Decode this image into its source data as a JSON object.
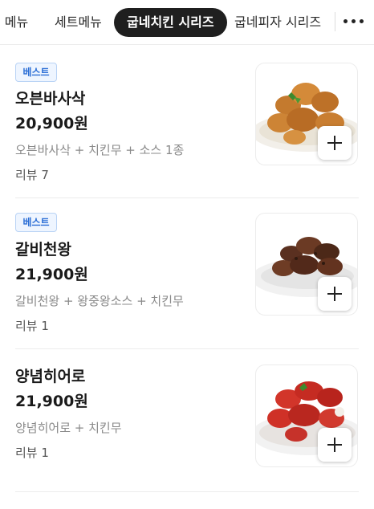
{
  "tabs": [
    {
      "label": "크 메뉴"
    },
    {
      "label": "세트메뉴"
    },
    {
      "label": "굽네치킨 시리즈",
      "active": true
    },
    {
      "label": "굽네피자 시리즈"
    }
  ],
  "more_icon": "more-horizontal-icon",
  "items": [
    {
      "badge": "베스트",
      "name": "오븐바사삭",
      "price": "20,900원",
      "desc": "오븐바사삭 + 치킨무 + 소스 1종",
      "review": "리뷰 7",
      "image": "fried-chicken-image"
    },
    {
      "badge": "베스트",
      "name": "갈비천왕",
      "price": "21,900원",
      "desc": "갈비천왕 + 왕중왕소스 + 치킨무",
      "review": "리뷰 1",
      "image": "galbi-chicken-image"
    },
    {
      "name": "양념히어로",
      "price": "21,900원",
      "desc": "양념히어로 + 치킨무",
      "review": "리뷰 1",
      "image": "seasoned-chicken-image"
    }
  ],
  "colors": {
    "accent": "#1f1f1f",
    "badge_text": "#2c6fd6",
    "badge_bg": "#eef5ff"
  }
}
